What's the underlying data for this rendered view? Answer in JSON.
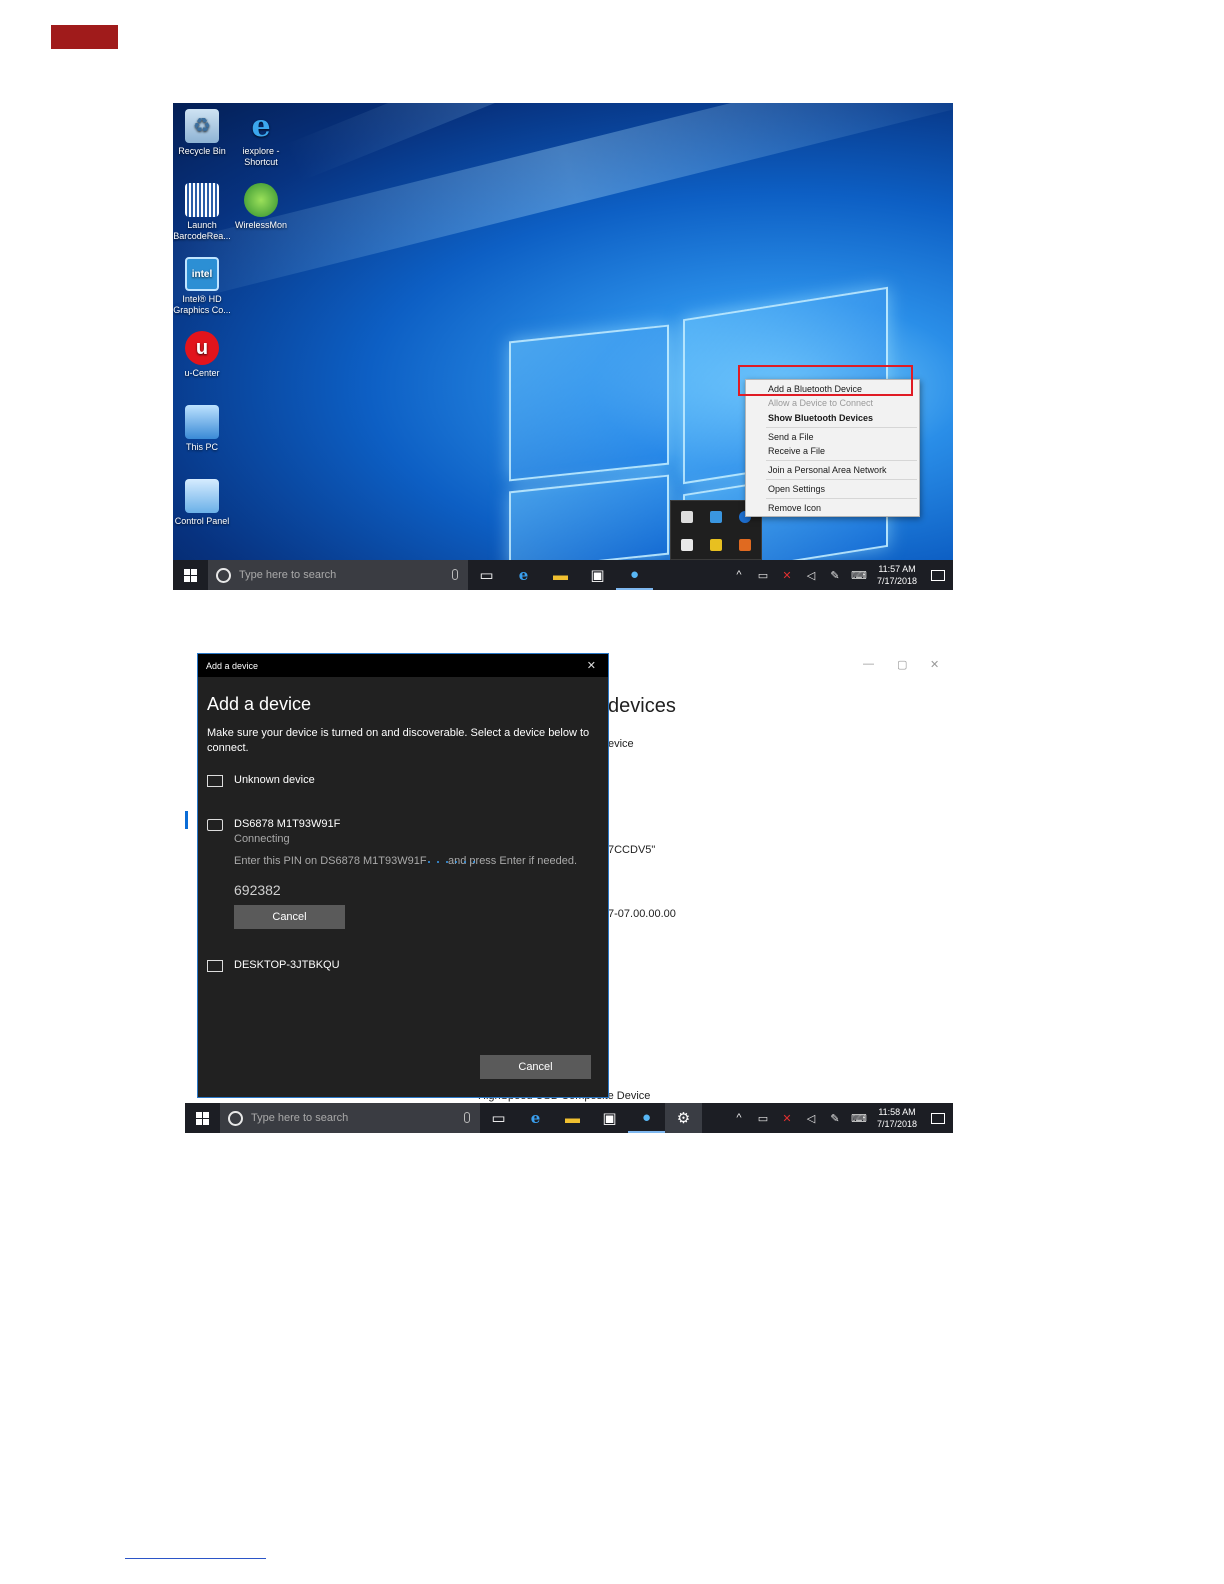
{
  "desktop": {
    "icons": [
      {
        "label": "Recycle Bin",
        "icon": "recycle-bin-icon"
      },
      {
        "label": "iexplore - Shortcut",
        "icon": "internet-explorer-icon"
      },
      {
        "label": "Launch BarcodeRea...",
        "icon": "barcode-icon"
      },
      {
        "label": "WirelessMon",
        "icon": "wireless-icon"
      },
      {
        "label": "Intel® HD Graphics Co...",
        "icon": "intel-graphics-icon"
      },
      {
        "label": "u-Center",
        "icon": "u-center-icon"
      },
      {
        "label": "This PC",
        "icon": "this-pc-icon"
      },
      {
        "label": "Control Panel",
        "icon": "control-panel-icon"
      }
    ],
    "context_menu": [
      {
        "label": "Add a Bluetooth Device",
        "state": "normal"
      },
      {
        "label": "Allow a Device to Connect",
        "state": "disabled"
      },
      {
        "label": "Show Bluetooth Devices",
        "state": "bold"
      },
      {
        "label": "Send a File",
        "state": "normal"
      },
      {
        "label": "Receive a File",
        "state": "normal"
      },
      {
        "label": "Join a Personal Area Network",
        "state": "normal"
      },
      {
        "label": "Open Settings",
        "state": "normal"
      },
      {
        "label": "Remove Icon",
        "state": "normal"
      }
    ],
    "highlight_color": "#e01b24",
    "taskbar": {
      "search_placeholder": "Type here to search",
      "time": "11:57 AM",
      "date": "7/17/2018"
    }
  },
  "settings_window": {
    "title_fragment": "devices",
    "line1": "evice",
    "line2": "7CCDV5\"",
    "line3": "7-07.00.00.00",
    "line4": "HighSpeed USB Composite Device"
  },
  "add_device_dialog": {
    "window_title": "Add a device",
    "heading": "Add a device",
    "description": "Make sure your device is turned on and discoverable. Select a device below to connect.",
    "devices": [
      {
        "name": "Unknown device",
        "icon": "unknown-device-icon"
      },
      {
        "name": "DS6878 M1T93W91F",
        "icon": "keyboard-icon",
        "status": "Connecting",
        "instruction_a": "Enter this PIN on DS6878 M1T93W91F",
        "instruction_b": "and press Enter if needed.",
        "pin": "692382",
        "cancel_label": "Cancel"
      },
      {
        "name": "DESKTOP-3JTBKQU",
        "icon": "computer-icon"
      }
    ],
    "footer_cancel_label": "Cancel"
  },
  "taskbar2": {
    "search_placeholder": "Type here to search",
    "time": "11:58 AM",
    "date": "7/17/2018"
  },
  "colors": {
    "header_bar": "#a01b1b",
    "dialog_bg": "#212121",
    "accent_blue": "#0a6cd6"
  }
}
